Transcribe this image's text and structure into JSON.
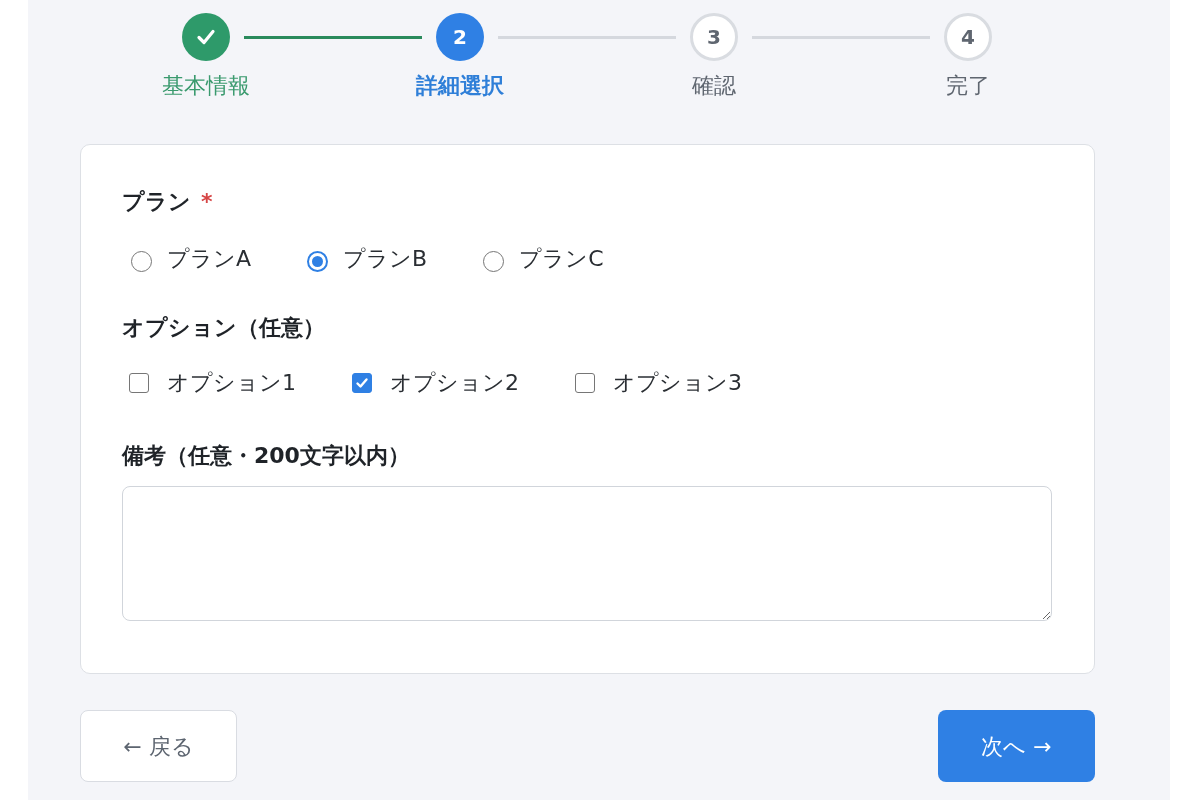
{
  "steps": [
    {
      "label": "基本情報",
      "completed": true,
      "active": false
    },
    {
      "number": "2",
      "label": "詳細選択",
      "completed": false,
      "active": true
    },
    {
      "number": "3",
      "label": "確認",
      "completed": false,
      "active": false
    },
    {
      "number": "4",
      "label": "完了",
      "completed": false,
      "active": false
    }
  ],
  "form": {
    "fields": [
      {
        "kind": "radio",
        "label": "プラン",
        "required_mark": "*",
        "options": [
          {
            "label": "プランA",
            "selected": false
          },
          {
            "label": "プランB",
            "selected": true
          },
          {
            "label": "プランC",
            "selected": false
          }
        ]
      },
      {
        "kind": "checkbox",
        "label": "オプション（任意）",
        "options": [
          {
            "label": "オプション1",
            "checked": false
          },
          {
            "label": "オプション2",
            "checked": true
          },
          {
            "label": "オプション3",
            "checked": false
          }
        ]
      },
      {
        "kind": "textarea",
        "label": "備考（任意・200文字以内）"
      }
    ]
  },
  "buttons": {
    "back": {
      "label": "← 戻る"
    },
    "next": {
      "label": "次へ →"
    }
  }
}
